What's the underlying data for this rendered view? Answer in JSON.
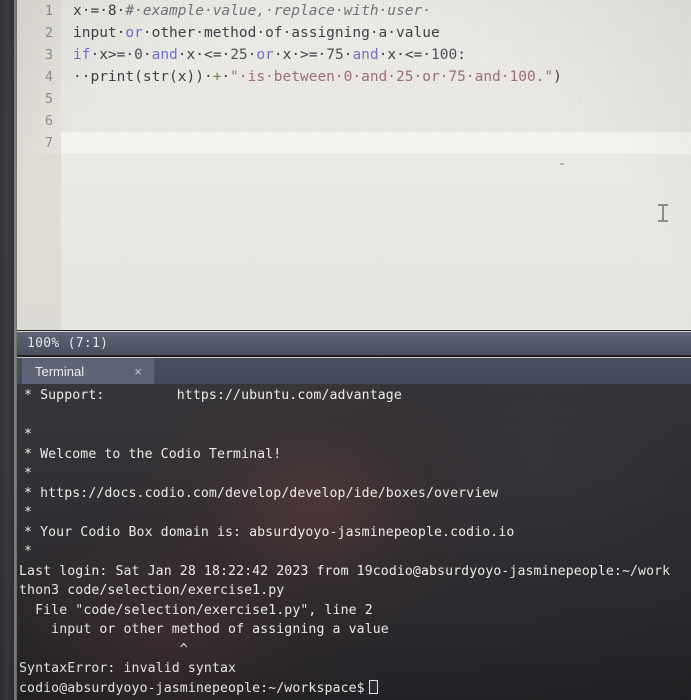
{
  "editor": {
    "lines": [
      {
        "number": "1",
        "tokens": [
          {
            "t": "x·=·8·",
            "c": "plain"
          },
          {
            "t": "#·example·value,·replace·with·user·",
            "c": "comment"
          }
        ]
      },
      {
        "number": "2",
        "tokens": [
          {
            "t": "input·",
            "c": "plain"
          },
          {
            "t": "or",
            "c": "keyword"
          },
          {
            "t": "·other·method·of·assigning·a·value",
            "c": "plain"
          }
        ]
      },
      {
        "number": "3",
        "tokens": [
          {
            "t": "if",
            "c": "keyword"
          },
          {
            "t": "·x>=·",
            "c": "plain"
          },
          {
            "t": "0",
            "c": "number"
          },
          {
            "t": "·",
            "c": "plain"
          },
          {
            "t": "and",
            "c": "keyword"
          },
          {
            "t": "·x·<=·",
            "c": "plain"
          },
          {
            "t": "25",
            "c": "number"
          },
          {
            "t": "·",
            "c": "plain"
          },
          {
            "t": "or",
            "c": "keyword"
          },
          {
            "t": "·x·>=·",
            "c": "plain"
          },
          {
            "t": "75",
            "c": "number"
          },
          {
            "t": "·",
            "c": "plain"
          },
          {
            "t": "and",
            "c": "keyword"
          },
          {
            "t": "·x·<=·",
            "c": "plain"
          },
          {
            "t": "100",
            "c": "number"
          },
          {
            "t": ":",
            "c": "plain"
          }
        ]
      },
      {
        "number": "4",
        "tokens": [
          {
            "t": "··print(str(x))·",
            "c": "plain"
          },
          {
            "t": "+",
            "c": "operator"
          },
          {
            "t": "·",
            "c": "plain"
          },
          {
            "t": "\"·is·between·0·and·25·or·75·and·100.\"",
            "c": "string"
          },
          {
            "t": ")",
            "c": "plain"
          }
        ]
      },
      {
        "number": "5",
        "tokens": []
      },
      {
        "number": "6",
        "tokens": []
      },
      {
        "number": "7",
        "tokens": []
      }
    ]
  },
  "statusbar": {
    "text": "100%  (7:1)"
  },
  "terminal_tabs": {
    "active_label": "Terminal",
    "close_glyph": "×"
  },
  "terminal": {
    "lines": [
      {
        "text": "* Support:         https://ubuntu.com/advantage",
        "flush": false
      },
      {
        "text": "",
        "flush": false
      },
      {
        "text": "*",
        "flush": false
      },
      {
        "text": "* Welcome to the Codio Terminal!",
        "flush": false
      },
      {
        "text": "*",
        "flush": false
      },
      {
        "text": "* https://docs.codio.com/develop/develop/ide/boxes/overview",
        "flush": false
      },
      {
        "text": "*",
        "flush": false
      },
      {
        "text": "* Your Codio Box domain is: absurdyoyo-jasminepeople.codio.io",
        "flush": false
      },
      {
        "text": "*",
        "flush": false
      },
      {
        "text": "Last login: Sat Jan 28 18:22:42 2023 from 19codio@absurdyoyo-jasminepeople:~/work",
        "flush": true
      },
      {
        "text": "thon3 code/selection/exercise1.py",
        "flush": true
      },
      {
        "text": "  File \"code/selection/exercise1.py\", line 2",
        "flush": true
      },
      {
        "text": "    input or other method of assigning a value",
        "flush": true
      },
      {
        "text": "                    ^",
        "flush": true
      },
      {
        "text": "SyntaxError: invalid syntax",
        "flush": true
      }
    ],
    "prompt": "codio@absurdyoyo-jasminepeople:~/workspace$"
  }
}
